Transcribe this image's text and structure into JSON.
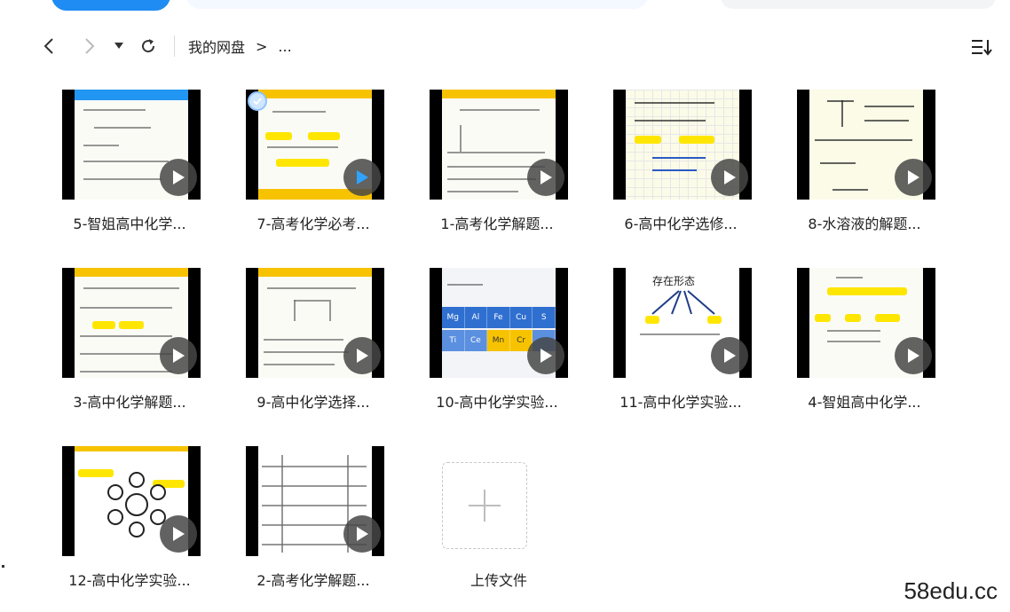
{
  "nav": {
    "breadcrumb_root": "我的网盘",
    "breadcrumb_separator": ">",
    "breadcrumb_more": "..."
  },
  "files": [
    {
      "label": "5-智姐高中化学...",
      "type": "video"
    },
    {
      "label": "7-高考化学必考...",
      "type": "video"
    },
    {
      "label": "1-高考化学解题...",
      "type": "video"
    },
    {
      "label": "6-高中化学选修...",
      "type": "video"
    },
    {
      "label": "8-水溶液的解题...",
      "type": "video"
    },
    {
      "label": "3-高中化学解题...",
      "type": "video"
    },
    {
      "label": "9-高中化学选择...",
      "type": "video"
    },
    {
      "label": "10-高中化学实验...",
      "type": "video"
    },
    {
      "label": "11-高中化学实验...",
      "type": "video"
    },
    {
      "label": "4-智姐高中化学...",
      "type": "video"
    },
    {
      "label": "12-高中化学实验...",
      "type": "video"
    },
    {
      "label": "2-高考化学解题...",
      "type": "video"
    }
  ],
  "upload": {
    "label": "上传文件"
  },
  "thumb_text": {
    "t11_title": "存在形态",
    "t10_elements_row1": [
      "Mg",
      "Al",
      "Fe",
      "Cu",
      "S"
    ],
    "t10_elements_row2": [
      "Ti",
      "Ce",
      "Mn",
      "Cr"
    ]
  },
  "watermark": "58edu.cc",
  "colors": {
    "accent": "#1e8cf3",
    "highlight": "#ffe600",
    "thumb_yellow": "#f7c300",
    "play_bg": "#464646"
  }
}
